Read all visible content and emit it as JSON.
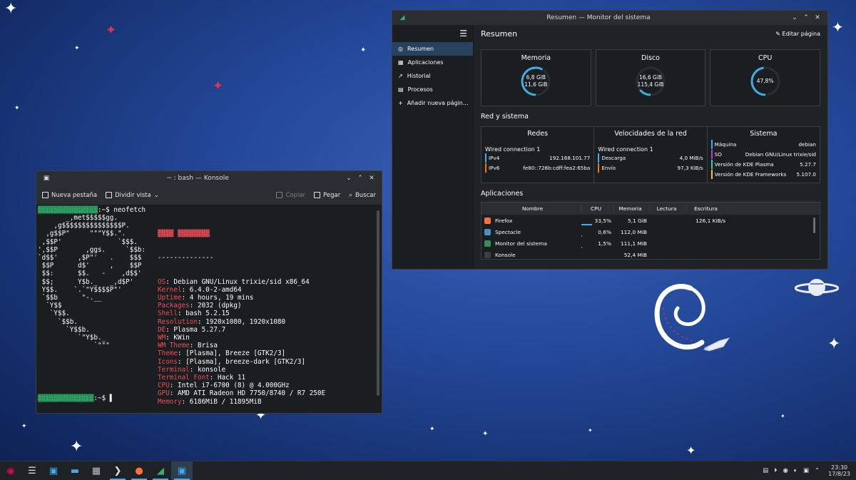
{
  "konsole": {
    "title": "~ : bash — Konsole",
    "toolbar": {
      "new_tab": "Nueva pestaña",
      "split_view": "Dividir vista",
      "copy": "Copiar",
      "paste": "Pegar",
      "search": "Buscar"
    },
    "command": "neofetch",
    "ascii_logo": "       _,met$$$$$gg.\n    ,g$$$$$$$$$$$$$$$P.\n  ,g$$P\"     \"\"\"Y$$.\".\n ,$$P'              `$$$.\n',$$P       ,ggs.     `$$b:\n`d$$'     ,$P\"'   .    $$$\n $$P      d$'     ,    $$P\n $$:      $$.   -    ,d$$'\n $$;      Y$b._   _,d$P'\n Y$$.    `.`\"Y$$$$P\"'\n `$$b      \"-.__\n  `Y$$\n   `Y$$.\n     `$$b.\n       `Y$$b.\n          `\"Y$b._\n              `\"\"\"",
    "separator": "--------------",
    "info": [
      {
        "key": "OS",
        "value": "Debian GNU/Linux trixie/sid x86_64"
      },
      {
        "key": "Kernel",
        "value": "6.4.0-2-amd64"
      },
      {
        "key": "Uptime",
        "value": "4 hours, 19 mins"
      },
      {
        "key": "Packages",
        "value": "2032 (dpkg)"
      },
      {
        "key": "Shell",
        "value": "bash 5.2.15"
      },
      {
        "key": "Resolution",
        "value": "1920x1080, 1920x1080"
      },
      {
        "key": "DE",
        "value": "Plasma 5.27.7"
      },
      {
        "key": "WM",
        "value": "KWin"
      },
      {
        "key": "WM Theme",
        "value": "Brisa"
      },
      {
        "key": "Theme",
        "value": "[Plasma], Breeze [GTK2/3]"
      },
      {
        "key": "Icons",
        "value": "[Plasma], breeze-dark [GTK2/3]"
      },
      {
        "key": "Terminal",
        "value": "konsole"
      },
      {
        "key": "Terminal Font",
        "value": "Hack 11"
      },
      {
        "key": "CPU",
        "value": "Intel i7-6700 (8) @ 4.000GHz"
      },
      {
        "key": "GPU",
        "value": "AMD ATI Radeon HD 7750/8740 / R7 250E"
      },
      {
        "key": "Memory",
        "value": "6186MiB / 11895MiB"
      }
    ],
    "palette_top": [
      "#1b1e20",
      "#555555",
      "#ed1515",
      "#11d116",
      "#f67400",
      "#1d99f3",
      "#9b59b6",
      "#1abc9c",
      "#fcfcfc"
    ],
    "palette_bottom": [
      "#7f8c8d",
      "#c0392b",
      "#1cdc9a",
      "#fdbc4b",
      "#3daee9",
      "#8e44ad",
      "#16a085",
      "#ffffff",
      "#ffffff"
    ]
  },
  "sysmon": {
    "title": "Resumen — Monitor del sistema",
    "page_title": "Resumen",
    "edit_page": "Editar página",
    "sidebar": [
      {
        "label": "Resumen",
        "active": true,
        "icon": "overview-icon"
      },
      {
        "label": "Aplicaciones",
        "active": false,
        "icon": "apps-grid-icon"
      },
      {
        "label": "Historial",
        "active": false,
        "icon": "history-chart-icon"
      },
      {
        "label": "Procesos",
        "active": false,
        "icon": "processes-icon"
      },
      {
        "label": "Añadir nueva págin...",
        "active": false,
        "icon": "plus-icon"
      }
    ],
    "cards": [
      {
        "title": "Memoria",
        "line1": "6,8 GiB",
        "line2": "11,6 GiB",
        "fraction": 0.58
      },
      {
        "title": "Disco",
        "line1": "16,6 GiB",
        "line2": "115,4 GiB",
        "fraction": 0.14
      },
      {
        "title": "CPU",
        "line1": "47,8%",
        "line2": "",
        "fraction": 0.478
      }
    ],
    "network_section": "Red y sistema",
    "network": {
      "redes": {
        "title": "Redes",
        "subtitle": "Wired connection 1",
        "rows": [
          {
            "k": "IPv4",
            "v": "192.168.101.77"
          },
          {
            "k": "IPv6",
            "v": "fe80::728b:cdff:fea2:65ba"
          }
        ]
      },
      "speeds": {
        "title": "Velocidades de la red",
        "subtitle": "Wired connection 1",
        "rows": [
          {
            "k": "Descarga",
            "v": "4,0 MiB/s"
          },
          {
            "k": "Envío",
            "v": "97,3 KiB/s"
          }
        ]
      },
      "system": {
        "title": "Sistema",
        "rows": [
          {
            "k": "Máquina",
            "v": "debian"
          },
          {
            "k": "SO",
            "v": "Debian GNU/Linux trixie/sid"
          },
          {
            "k": "Versión de KDE Plasma",
            "v": "5.27.7"
          },
          {
            "k": "Versión de KDE Frameworks",
            "v": "5.107.0"
          }
        ]
      }
    },
    "apps_section": "Aplicaciones",
    "apps_columns": [
      "Nombre",
      "CPU",
      "Memoria",
      "Lectura",
      "Escritura"
    ],
    "apps": [
      {
        "name": "Firefox",
        "cpu": "33,5%",
        "cpu_fraction": 0.335,
        "mem": "5,1 GiB",
        "read": "",
        "write": "126,1 KiB/s",
        "color": "#ff7139"
      },
      {
        "name": "Spectacle",
        "cpu": "0,6%",
        "cpu_fraction": 0.006,
        "mem": "112,0 MiB",
        "read": "",
        "write": "",
        "color": "#4a90c2"
      },
      {
        "name": "Monitor del sistema",
        "cpu": "1,5%",
        "cpu_fraction": 0.015,
        "mem": "111,1 MiB",
        "read": "",
        "write": "",
        "color": "#2f8f5a"
      },
      {
        "name": "Konsole",
        "cpu": "",
        "cpu_fraction": 0,
        "mem": "52,4 MiB",
        "read": "",
        "write": "",
        "color": "#3a3f44"
      }
    ]
  },
  "taskbar": {
    "clock_time": "23:30",
    "clock_date": "17/8/23",
    "apps": [
      {
        "icon": "debian-menu-icon",
        "open": false
      },
      {
        "icon": "settings-icon",
        "open": false
      },
      {
        "icon": "discover-store-icon",
        "open": false
      },
      {
        "icon": "dolphin-folder-icon",
        "open": false
      },
      {
        "icon": "calculator-icon",
        "open": false
      },
      {
        "icon": "konsole-icon",
        "open": true
      },
      {
        "icon": "firefox-icon",
        "open": true
      },
      {
        "icon": "system-monitor-icon",
        "open": true
      },
      {
        "icon": "spectacle-icon",
        "open": true
      }
    ]
  },
  "colors": {
    "accent": "#3daee9",
    "neofetch_key": "#ed4c56",
    "panel": "#1e2226"
  }
}
